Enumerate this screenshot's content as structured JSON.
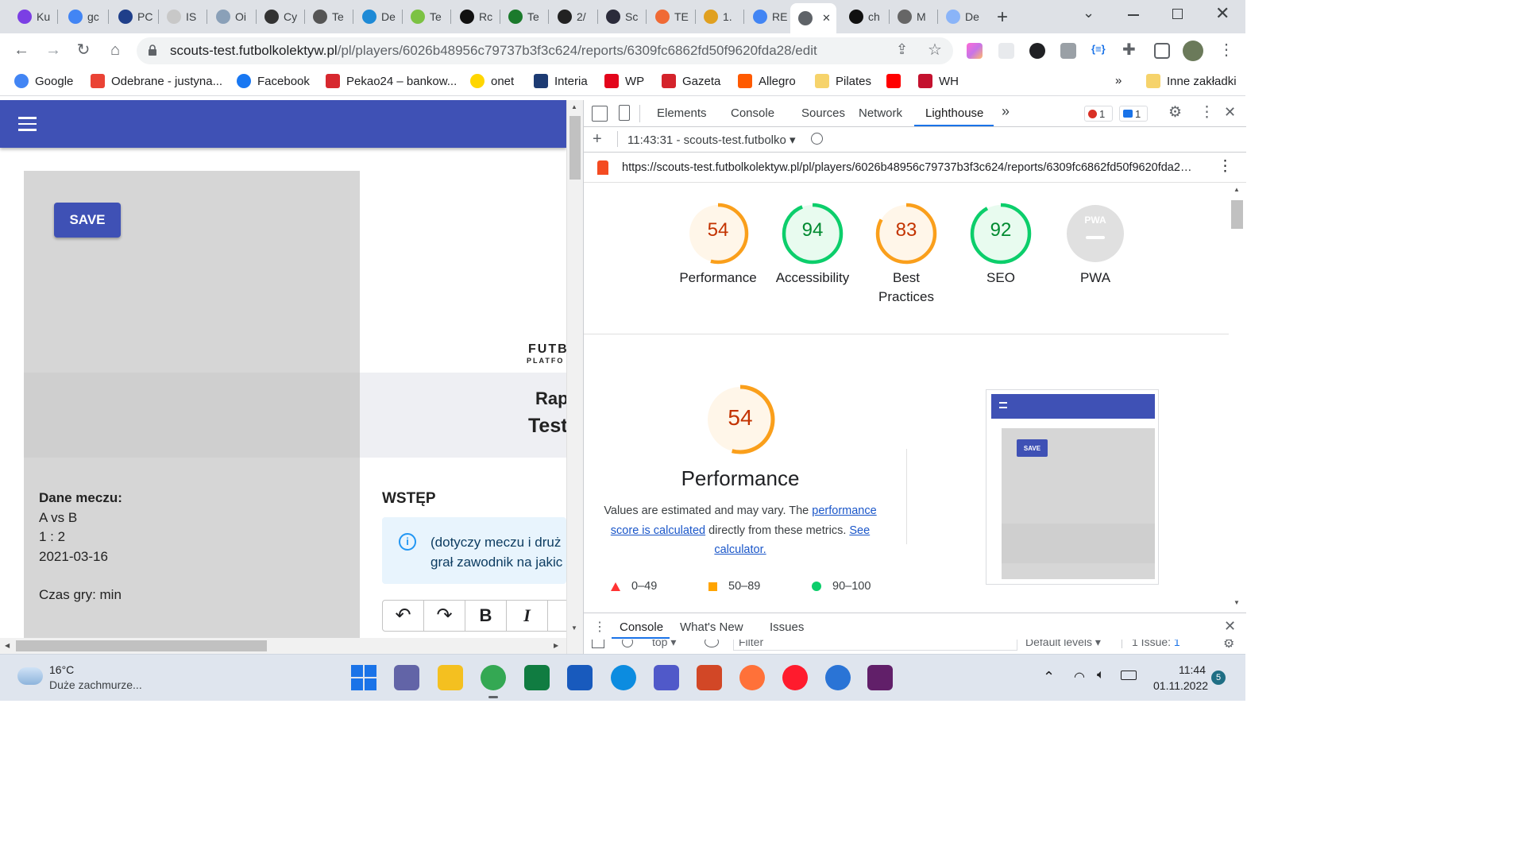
{
  "browser": {
    "tabs": [
      {
        "label": "Ku",
        "color": "#7b3fe4"
      },
      {
        "label": "gc",
        "color": "#4285f4"
      },
      {
        "label": "PC",
        "color": "#1f3f8a"
      },
      {
        "label": "IS",
        "color": "#c8c8c8"
      },
      {
        "label": "Oi",
        "color": "#8aa0b8"
      },
      {
        "label": "Cy",
        "color": "#333333"
      },
      {
        "label": "Te",
        "color": "#555555"
      },
      {
        "label": "De",
        "color": "#1e8ad6"
      },
      {
        "label": "Te",
        "color": "#7cc243"
      },
      {
        "label": "Rc",
        "color": "#111111"
      },
      {
        "label": "Te",
        "color": "#1b7a2c"
      },
      {
        "label": "2/",
        "color": "#222222"
      },
      {
        "label": "Sc",
        "color": "#2b2b3a"
      },
      {
        "label": "TE",
        "color": "#f06a35"
      },
      {
        "label": "1.",
        "color": "#e0a020"
      },
      {
        "label": "RE",
        "color": "#4285f4"
      },
      {
        "label": "",
        "color": "#5f6368",
        "active": true
      },
      {
        "label": "ch",
        "color": "#111111"
      },
      {
        "label": "M",
        "color": "#666666"
      },
      {
        "label": "De",
        "color": "#8ab4f8"
      }
    ],
    "url_host": "scouts-test.futbolkolektyw.pl",
    "url_path": "/pl/players/6026b48956c79737b3f3c624/reports/6309fc6862fd50f9620fda28/edit",
    "bookmarks": [
      {
        "label": "Google",
        "color": "#4285f4"
      },
      {
        "label": "Odebrane - justyna...",
        "color": "#ea4335"
      },
      {
        "label": "Facebook",
        "color": "#1877f2"
      },
      {
        "label": "Pekao24 – bankow...",
        "color": "#d7282f"
      },
      {
        "label": "onet",
        "color": "#ffd600"
      },
      {
        "label": "Interia",
        "color": "#1d3b73"
      },
      {
        "label": "WP",
        "color": "#e3051b"
      },
      {
        "label": "Gazeta",
        "color": "#d4232b"
      },
      {
        "label": "Allegro",
        "color": "#ff5a00"
      },
      {
        "label": "Pilates",
        "color": "#f6d36b"
      },
      {
        "label": "",
        "color": "#ff0000"
      },
      {
        "label": "WH",
        "color": "#c4122f"
      }
    ],
    "bookmarks_more": "»",
    "other_bookmarks": "Inne zakładki"
  },
  "page": {
    "save_label": "SAVE",
    "logo_top": "FUTB",
    "logo_bottom": "PLATFO",
    "report_title_1": "Rap",
    "report_title_2": "Test",
    "match_heading": "Dane meczu:",
    "match_teams": "A vs B",
    "match_score": "1 : 2",
    "match_date": "2021-03-16",
    "game_time": "Czas gry: min",
    "section_title": "WSTĘP",
    "info_line_1": "(dotyczy meczu i druż",
    "info_line_2": "grał zawodnik na jakic",
    "editor_tools": [
      "undo",
      "redo",
      "B",
      "I"
    ]
  },
  "devtools": {
    "tabs": [
      "Elements",
      "Console",
      "Sources",
      "Network",
      "Lighthouse"
    ],
    "active_tab": "Lighthouse",
    "more": "»",
    "errors": "1",
    "messages": "1",
    "report_select": "11:43:31 - scouts-test.futbolko",
    "report_url": "https://scouts-test.futbolkolektyw.pl/pl/players/6026b48956c79737b3f3c624/reports/6309fc6862fd50f9620fda2…",
    "scores": [
      {
        "label": "Performance",
        "value": 54,
        "color": "#fa9f1b",
        "text": "#c33300",
        "bg": "#fff6e9"
      },
      {
        "label": "Accessibility",
        "value": 94,
        "color": "#0cce6b",
        "text": "#008a30",
        "bg": "#e8fbef"
      },
      {
        "label": "Best Practices",
        "value": 83,
        "color": "#fa9f1b",
        "text": "#c33300",
        "bg": "#fff6e9"
      },
      {
        "label": "SEO",
        "value": 92,
        "color": "#0cce6b",
        "text": "#008a30",
        "bg": "#e8fbef"
      },
      {
        "label": "PWA",
        "value": null,
        "color": "#c8c8c8",
        "text": "#ffffff",
        "bg": "#e0e0e0"
      }
    ],
    "pwa_badge": "PWA",
    "perf_score": "54",
    "perf_title": "Performance",
    "perf_desc_1": "Values are estimated and may vary. The ",
    "perf_link_1": "performance score is calculated",
    "perf_desc_2": " directly from these metrics. ",
    "perf_link_2": "See calculator.",
    "legend": [
      {
        "range": "0–49",
        "color": "#ff3333",
        "shape": "triangle"
      },
      {
        "range": "50–89",
        "color": "#ffa400",
        "shape": "square"
      },
      {
        "range": "90–100",
        "color": "#0cce6b",
        "shape": "circle"
      }
    ],
    "thumb_save": "SAVE",
    "drawer_tabs": [
      "Console",
      "What's New",
      "Issues"
    ],
    "drawer_active": "Console",
    "drawer_context": "top",
    "drawer_filter": "Filter",
    "drawer_levels": "Default levels",
    "drawer_issues": "1 Issue:",
    "drawer_issues_count": "1"
  },
  "taskbar": {
    "weather_temp": "16°C",
    "weather_desc": "Duże zachmurze...",
    "time": "11:44",
    "date": "01.11.2022",
    "notifications": "5",
    "apps": [
      {
        "name": "start-icon",
        "color": "#1a73e8"
      },
      {
        "name": "teams-chat-icon",
        "color": "#6264a7"
      },
      {
        "name": "file-explorer-icon",
        "color": "#f4c020"
      },
      {
        "name": "chrome-icon",
        "color": "#34a853"
      },
      {
        "name": "excel-icon",
        "color": "#107c41"
      },
      {
        "name": "word-icon",
        "color": "#185abd"
      },
      {
        "name": "edge-icon",
        "color": "#0c8ce0"
      },
      {
        "name": "teams-icon",
        "color": "#5059c9"
      },
      {
        "name": "powerpoint-icon",
        "color": "#d24726"
      },
      {
        "name": "firefox-icon",
        "color": "#ff7139"
      },
      {
        "name": "opera-icon",
        "color": "#ff1b2d"
      },
      {
        "name": "thunderbird-icon",
        "color": "#2a74d6"
      },
      {
        "name": "slack-icon",
        "color": "#611f69"
      }
    ]
  }
}
